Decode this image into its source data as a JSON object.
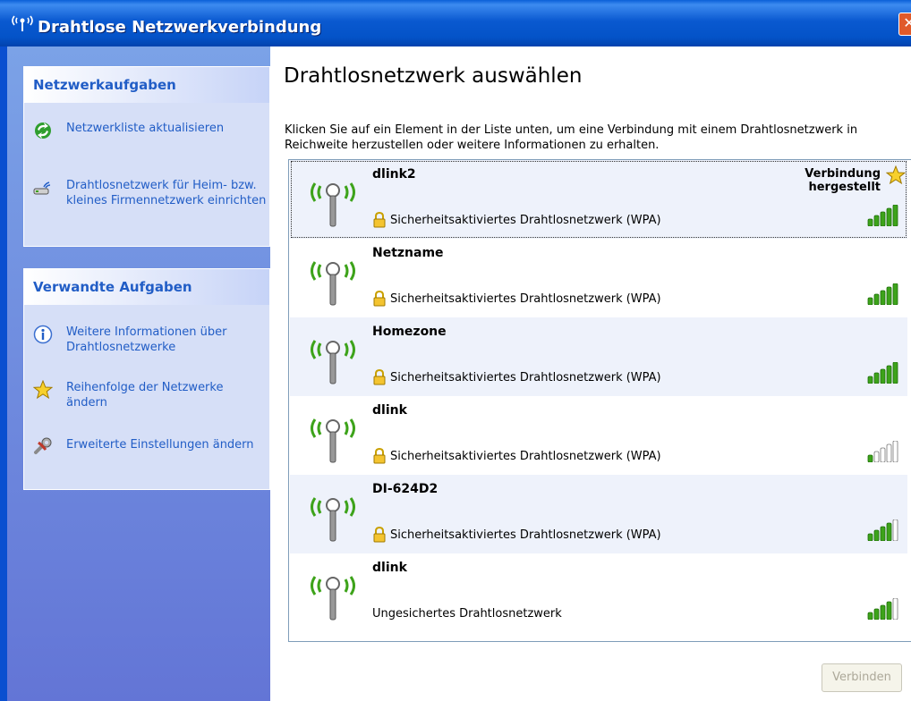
{
  "window": {
    "title": "Drahtlose Netzwerkverbindung",
    "close_label": "✕"
  },
  "left": {
    "network_tasks": {
      "title": "Netzwerkaufgaben",
      "items": [
        {
          "label": "Netzwerkliste aktualisieren",
          "icon": "refresh-icon"
        },
        {
          "label": "Drahtlosnetzwerk für Heim- bzw. kleines Firmennetzwerk einrichten",
          "icon": "wireless-setup-icon"
        }
      ]
    },
    "related_tasks": {
      "title": "Verwandte Aufgaben",
      "items": [
        {
          "label": "Weitere Informationen über Drahtlosnetzwerke",
          "icon": "info-icon"
        },
        {
          "label": "Reihenfolge der Netzwerke ändern",
          "icon": "star-icon"
        },
        {
          "label": "Erweiterte Einstellungen ändern",
          "icon": "settings-icon"
        }
      ]
    }
  },
  "main": {
    "heading": "Drahtlosnetzwerk auswählen",
    "instructions": "Klicken Sie auf ein Element in der Liste unten, um eine Verbindung mit einem Drahtlosnetzwerk in Reichweite herzustellen oder weitere Informationen zu erhalten.",
    "networks": [
      {
        "name": "dlink2",
        "security": "Sicherheitsaktiviertes Drahtlosnetzwerk (WPA)",
        "secured": true,
        "signal_bars": 5,
        "status": "Verbindung hergestellt",
        "selected": true
      },
      {
        "name": "Netzname",
        "security": "Sicherheitsaktiviertes Drahtlosnetzwerk (WPA)",
        "secured": true,
        "signal_bars": 5
      },
      {
        "name": "Homezone",
        "security": "Sicherheitsaktiviertes Drahtlosnetzwerk (WPA)",
        "secured": true,
        "signal_bars": 5
      },
      {
        "name": "dlink",
        "security": "Sicherheitsaktiviertes Drahtlosnetzwerk (WPA)",
        "secured": true,
        "signal_bars": 1
      },
      {
        "name": "DI-624D2",
        "security": "Sicherheitsaktiviertes Drahtlosnetzwerk (WPA)",
        "secured": true,
        "signal_bars": 4
      },
      {
        "name": "dlink",
        "security": "Ungesichertes Drahtlosnetzwerk",
        "secured": false,
        "signal_bars": 4
      }
    ],
    "connect_button": "Verbinden"
  },
  "colors": {
    "titlebar": "#0a59d0",
    "task_link": "#215dc6",
    "signal_on": "#3da31a",
    "signal_off": "#ffffff"
  }
}
